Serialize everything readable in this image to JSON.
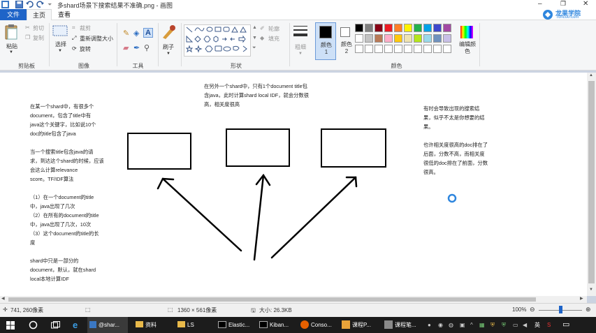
{
  "window": {
    "title": "多shard场景下搜索结果不准确.png - 画图",
    "controls": [
      "minimize-icon",
      "maximize-icon",
      "close-icon"
    ]
  },
  "watermark": {
    "line1": "龙果学院",
    "line2": "roncoo.com"
  },
  "ribbon_tabs": [
    "文件",
    "主页",
    "查看"
  ],
  "clipboard": {
    "paste": "粘贴",
    "cut": "剪切",
    "copy": "复制",
    "group": "剪贴板"
  },
  "image": {
    "select": "选择",
    "crop": "裁剪",
    "resize": "重新调整大小",
    "rotate": "旋转",
    "group": "图像"
  },
  "tools": {
    "group": "工具"
  },
  "brush": {
    "label": "刷子"
  },
  "shapes": {
    "outline": "轮廓",
    "fill": "填充",
    "group": "形状"
  },
  "size": {
    "label": "粗细"
  },
  "colors": {
    "color1": "颜色 1",
    "color2": "颜色 2",
    "edit": "编辑颜色",
    "group": "颜色",
    "palette_row1": [
      "#000000",
      "#7f7f7f",
      "#880015",
      "#ed1c24",
      "#ff7f27",
      "#fff200",
      "#22b14c",
      "#00a2e8",
      "#3f48cc",
      "#a349a4"
    ],
    "palette_row2": [
      "#ffffff",
      "#c3c3c3",
      "#b97a57",
      "#ffaec9",
      "#ffc90e",
      "#efe4b0",
      "#b5e61d",
      "#99d9ea",
      "#7092be",
      "#c8bfe7"
    ]
  },
  "canvas": {
    "left_note": "在某一个shard中，有很多个\ndocument，包含了title中有\njava这个关键字，比如说10个\ndoc的title包含了java\n\n当一个搜索title包含java的请\n求，到达这个shard的时候，应该\n会这么计算relevance\nscore。TF/IDF算法\n\n（1）在一个document的title\n中，java出现了几次\n（2）在所有的document的title\n中，java出现了几次，10次\n（3）这个document的title的长\n度\n\nshard中只是一部分的\ndocument，默认，就在shard\nlocal本地计算IDF",
    "top_note": "在另外一个shard中，只有1个document title包\n含java，此时计算shard local IDF，就会分数很\n高，相关度很高",
    "right_note": "有时会导致出现的搜索结\n果，似乎不太是你想要的结\n果。\n\n也许相关度很高的doc排在了\n后面，分数不高，而相关度\n很低的doc排在了前面，分数\n很高。"
  },
  "status": {
    "cursor_pos": "741, 260像素",
    "dimensions": "1360 × 561像素",
    "file_size": "大小: 26.3KB",
    "zoom": "100%",
    "zoom_level": 1.0
  },
  "taskbar": {
    "items": [
      "@shar...",
      "资料",
      "LS",
      "Elastic...",
      "Kiban...",
      "Conso...",
      "课程P...",
      "课程笔..."
    ],
    "ime": "英"
  }
}
